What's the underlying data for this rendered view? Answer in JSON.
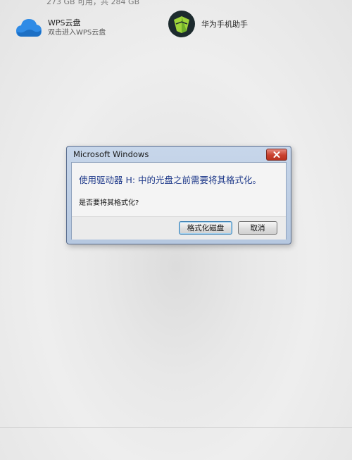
{
  "explorer": {
    "top_cut_text": "273 GB 可用，共 284 GB",
    "tiles": [
      {
        "title": "WPS云盘",
        "subtitle": "双击进入WPS云盘",
        "icon": "cloud-icon"
      },
      {
        "title": "华为手机助手",
        "icon": "huawei-hisuite-icon"
      }
    ]
  },
  "dialog": {
    "title": "Microsoft Windows",
    "main_message": "使用驱动器 H: 中的光盘之前需要将其格式化。",
    "question": "是否要将其格式化?",
    "buttons": {
      "format": "格式化磁盘",
      "cancel": "取消"
    },
    "close_icon": "close-icon"
  },
  "colors": {
    "message_blue": "#1f3a8a",
    "close_red": "#c9412f",
    "frame_blue": "#b6c8e0"
  }
}
